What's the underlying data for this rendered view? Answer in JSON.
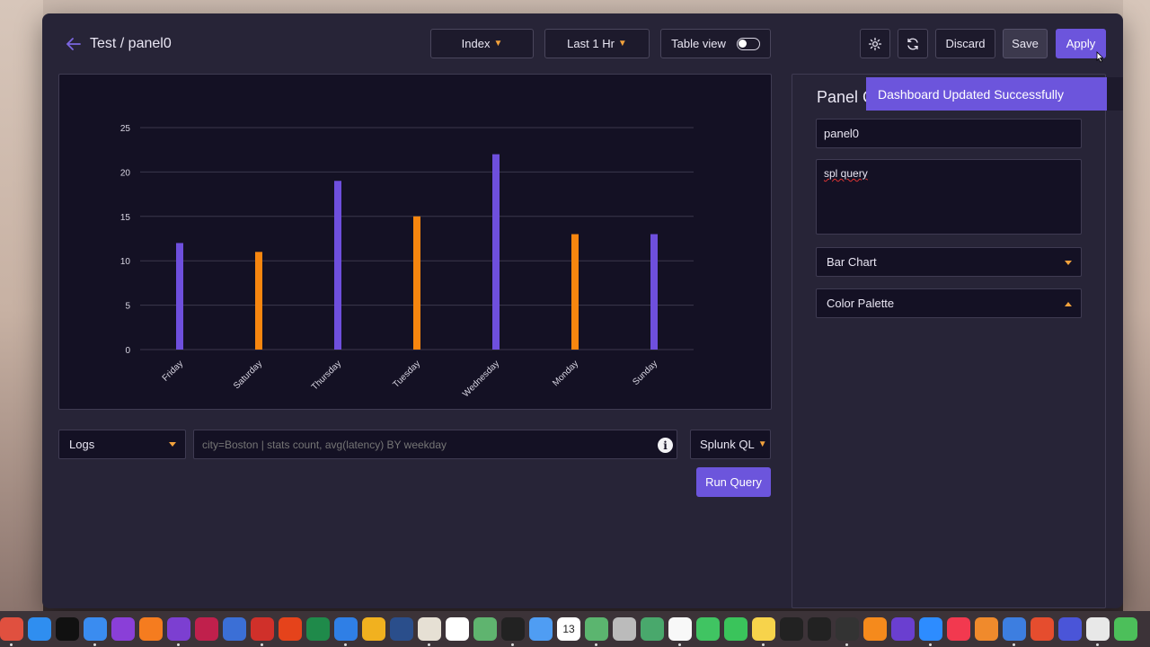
{
  "header": {
    "title": "Test / panel0",
    "index_label": "Index",
    "time_label": "Last 1 Hr",
    "table_view_label": "Table view",
    "discard_label": "Discard",
    "save_label": "Save",
    "apply_label": "Apply"
  },
  "chart_data": {
    "type": "bar",
    "categories": [
      "Friday",
      "Saturday",
      "Thursday",
      "Tuesday",
      "Wednesday",
      "Monday",
      "Sunday"
    ],
    "values": [
      12,
      11,
      19,
      15,
      22,
      13,
      13
    ],
    "bar_colors": [
      "#6e4fdd",
      "#f7860f",
      "#6e4fdd",
      "#f7860f",
      "#6e4fdd",
      "#f7860f",
      "#6e4fdd"
    ],
    "title": "",
    "xlabel": "",
    "ylabel": "",
    "ylim": [
      0,
      25
    ],
    "yticks": [
      0,
      5,
      10,
      15,
      20,
      25
    ],
    "grid": true
  },
  "query_bar": {
    "source": "Logs",
    "query_placeholder": "city=Boston | stats count, avg(latency) BY weekday",
    "language": "Splunk QL",
    "run_label": "Run Query"
  },
  "side_panel": {
    "heading": "Panel C",
    "panel_name": "panel0",
    "query_text": "spl query",
    "chart_type": "Bar Chart",
    "palette_label": "Color Palette"
  },
  "toast": {
    "message": "Dashboard Updated Successfully",
    "close": "✖"
  },
  "colors": {
    "accent": "#6c55dc",
    "orange": "#f3a23c",
    "background": "#272437",
    "panel": "#141124"
  },
  "dock": {
    "calendar_day": "13"
  }
}
